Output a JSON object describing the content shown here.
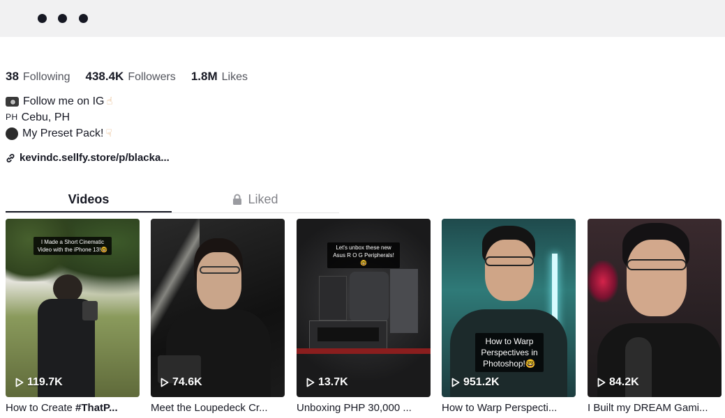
{
  "topbar": {
    "menu_icon": "more-dots-icon"
  },
  "stats": [
    {
      "value": "38",
      "label": "Following"
    },
    {
      "value": "438.4K",
      "label": "Followers"
    },
    {
      "value": "1.8M",
      "label": "Likes"
    }
  ],
  "bio": {
    "line1": "Follow me on IG",
    "line2_tag": "PH",
    "line2": "Cebu, PH",
    "line3": "My Preset Pack!"
  },
  "link": {
    "text": "kevindc.sellfy.store/p/blacka...",
    "icon": "link-icon"
  },
  "tabs": {
    "videos": "Videos",
    "liked": "Liked"
  },
  "videos": [
    {
      "views": "119.7K",
      "caption_prefix": "How to Create ",
      "caption_bold": "#ThatP...",
      "overlay": "I Made a Short Cinematic Video with the iPhone 13!🤓"
    },
    {
      "views": "74.6K",
      "caption": "Meet the Loupedeck Cr..."
    },
    {
      "views": "13.7K",
      "caption": "Unboxing PHP 30,000 ...",
      "overlay": "Let's unbox these new Asus R O G Peripherals!🤓"
    },
    {
      "views": "951.2K",
      "caption": "How to Warp Perspecti...",
      "overlay": "How to Warp Perspectives in Photoshop!🤓"
    },
    {
      "views": "84.2K",
      "caption": "I Built my DREAM Gami..."
    }
  ],
  "colors": {
    "text": "#161823",
    "muted": "#75767c",
    "topbar": "#f1f1f2"
  }
}
